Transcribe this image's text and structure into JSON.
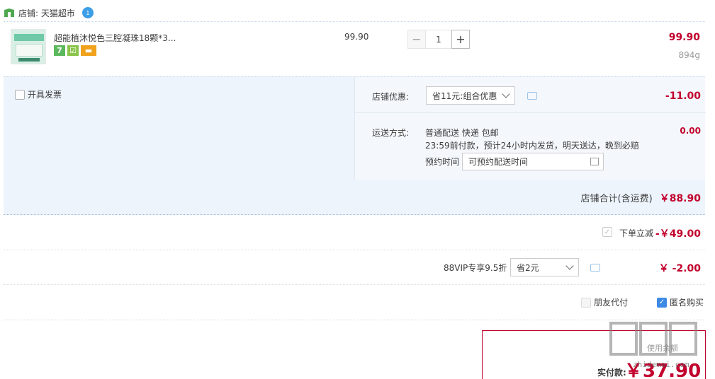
{
  "shop": {
    "label": "店铺: 天猫超市",
    "ww_badge": "1"
  },
  "item": {
    "title": "超能植沐悦色三腔凝珠18颗*3...",
    "badges": [
      "7",
      "☑",
      "▬"
    ],
    "unit_price": "99.90",
    "quantity": "1",
    "minus": "−",
    "plus": "+",
    "line_total": "99.90",
    "weight": "894g"
  },
  "invoice": {
    "label": "开具发票"
  },
  "shop_discount": {
    "label": "店铺优惠:",
    "selected": "省11元:组合优惠",
    "value": "-11.00"
  },
  "shipping": {
    "label": "运送方式:",
    "method": "普通配送 快递 包邮",
    "note": "23:59前付款，预计24小时内发货，明天送达，晚到必赔",
    "reserve_label": "预约时间",
    "reserve_value": "可预约配送时间",
    "fee": "0.00"
  },
  "shop_total": {
    "label": "店铺合计(含运费)",
    "value": "￥88.90"
  },
  "order_discount": {
    "label": "下单立减",
    "value": "-￥49.00"
  },
  "vip": {
    "label": "88VIP专享9.5折",
    "selected": "省2元",
    "value": "￥ -2.00"
  },
  "pay_options": {
    "friend_pay": "朋友代付",
    "anonymous": "匿名购买"
  },
  "payment": {
    "label": "实付款:",
    "amount": "￥37.90",
    "faint": "使用余额"
  },
  "watermark": {
    "text": "zhidemai.com"
  }
}
